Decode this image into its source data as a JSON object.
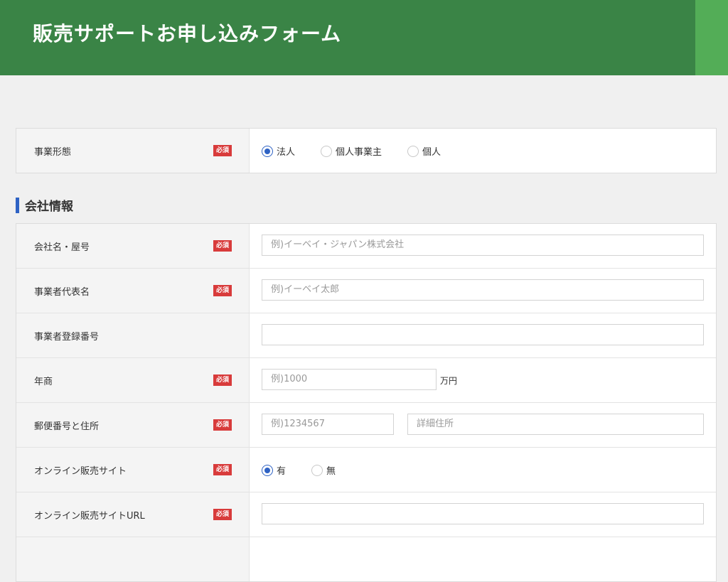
{
  "header": {
    "title": "販売サポートお申し込みフォーム"
  },
  "required_label": "必須",
  "business_type": {
    "label": "事業形態",
    "options": [
      "法人",
      "個人事業主",
      "個人"
    ],
    "selected": "法人"
  },
  "company_section": {
    "title": "会社情報",
    "company_name": {
      "label": "会社名・屋号",
      "placeholder": "例)イーベイ・ジャパン株式会社"
    },
    "representative": {
      "label": "事業者代表名",
      "placeholder": "例)イーベイ太郎"
    },
    "registration_number": {
      "label": "事業者登録番号",
      "placeholder": ""
    },
    "annual_sales": {
      "label": "年商",
      "placeholder": "例)1000",
      "unit": "万円"
    },
    "address": {
      "label": "郵便番号と住所",
      "postal_placeholder": "例)1234567",
      "detail_placeholder": "詳細住所"
    },
    "online_site": {
      "label": "オンライン販売サイト",
      "options": [
        "有",
        "無"
      ],
      "selected": "有"
    },
    "online_site_url": {
      "label": "オンライン販売サイトURL",
      "placeholder": ""
    }
  },
  "colors": {
    "header": "#3a8446",
    "header_accent": "#53ad57",
    "required": "#d83b3b",
    "accent": "#2e62c4"
  }
}
